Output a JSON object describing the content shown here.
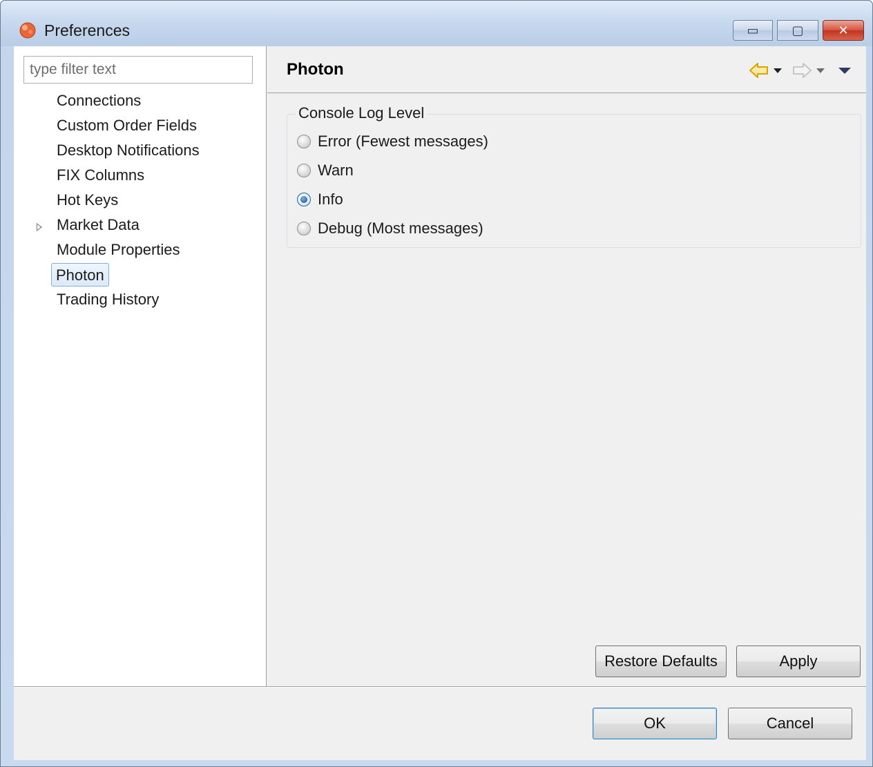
{
  "window": {
    "title": "Preferences",
    "minimize_glyph": "▭",
    "maximize_glyph": "▢",
    "close_glyph": "✕"
  },
  "filter": {
    "placeholder": "type filter text",
    "value": ""
  },
  "tree": {
    "items": [
      {
        "label": "Connections",
        "expandable": false
      },
      {
        "label": "Custom Order Fields",
        "expandable": false
      },
      {
        "label": "Desktop Notifications",
        "expandable": false
      },
      {
        "label": "FIX Columns",
        "expandable": false
      },
      {
        "label": "Hot Keys",
        "expandable": false
      },
      {
        "label": "Market Data",
        "expandable": true
      },
      {
        "label": "Module Properties",
        "expandable": false
      },
      {
        "label": "Photon",
        "expandable": false,
        "selected": true
      },
      {
        "label": "Trading History",
        "expandable": false
      }
    ]
  },
  "page": {
    "title": "Photon",
    "group_title": "Console Log Level",
    "options": [
      {
        "label": "Error (Fewest messages)",
        "checked": false
      },
      {
        "label": "Warn",
        "checked": false
      },
      {
        "label": "Info",
        "checked": true
      },
      {
        "label": "Debug (Most messages)",
        "checked": false
      }
    ],
    "restore_defaults_label": "Restore Defaults",
    "apply_label": "Apply"
  },
  "footer": {
    "ok_label": "OK",
    "cancel_label": "Cancel"
  },
  "colors": {
    "selection_border": "#84acdd",
    "back_arrow": "#f0b400",
    "close_button": "#c2331f"
  }
}
